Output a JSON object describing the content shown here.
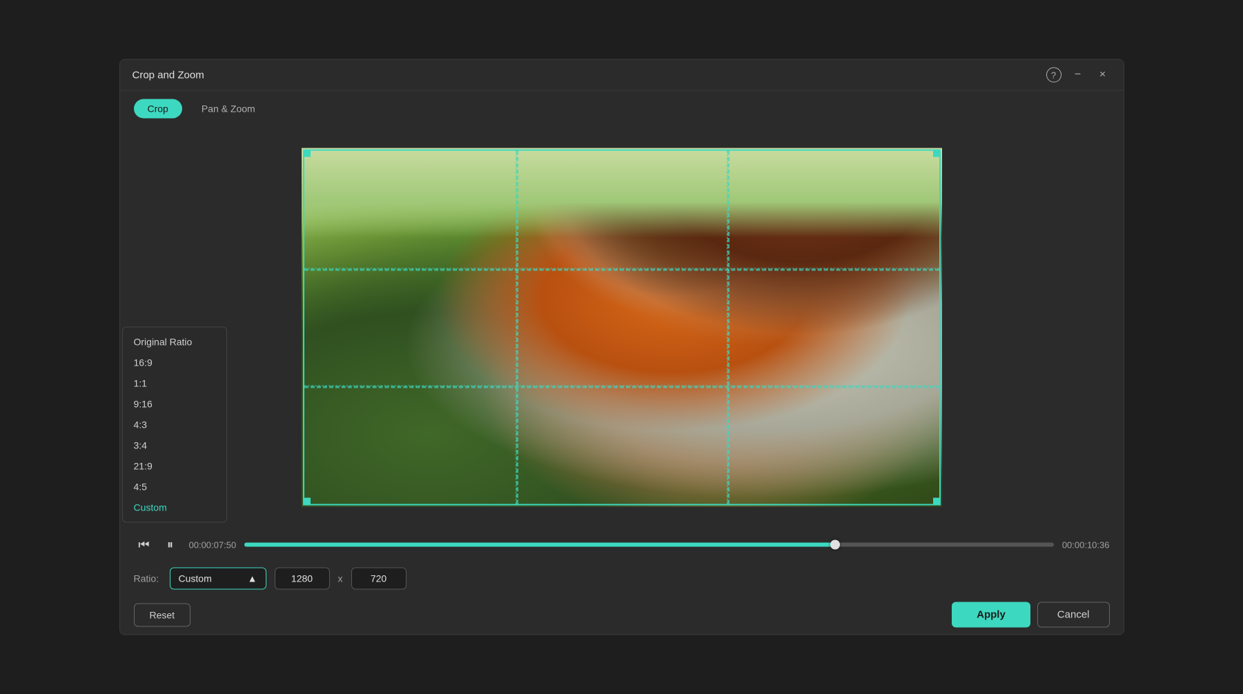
{
  "dialog": {
    "title": "Crop and Zoom",
    "help_icon": "?",
    "minimize_icon": "−",
    "close_icon": "×"
  },
  "tabs": [
    {
      "id": "crop",
      "label": "Crop",
      "active": true
    },
    {
      "id": "pan-zoom",
      "label": "Pan & Zoom",
      "active": false
    }
  ],
  "dropdown": {
    "items": [
      {
        "id": "original-ratio",
        "label": "Original Ratio"
      },
      {
        "id": "16-9",
        "label": "16:9"
      },
      {
        "id": "1-1",
        "label": "1:1"
      },
      {
        "id": "9-16",
        "label": "9:16"
      },
      {
        "id": "4-3",
        "label": "4:3"
      },
      {
        "id": "3-4",
        "label": "3:4"
      },
      {
        "id": "21-9",
        "label": "21:9"
      },
      {
        "id": "4-5",
        "label": "4:5"
      },
      {
        "id": "custom",
        "label": "Custom",
        "selected": true
      }
    ]
  },
  "playback": {
    "start_time": "00:00:07:50",
    "end_time": "00:00:10:36",
    "progress_percent": 73,
    "rewind_icon": "rewind",
    "pause_icon": "pause"
  },
  "ratio": {
    "label": "Ratio:",
    "selected": "Custom",
    "width": "1280",
    "height": "720",
    "x_separator": "x"
  },
  "actions": {
    "reset_label": "Reset",
    "apply_label": "Apply",
    "cancel_label": "Cancel"
  }
}
